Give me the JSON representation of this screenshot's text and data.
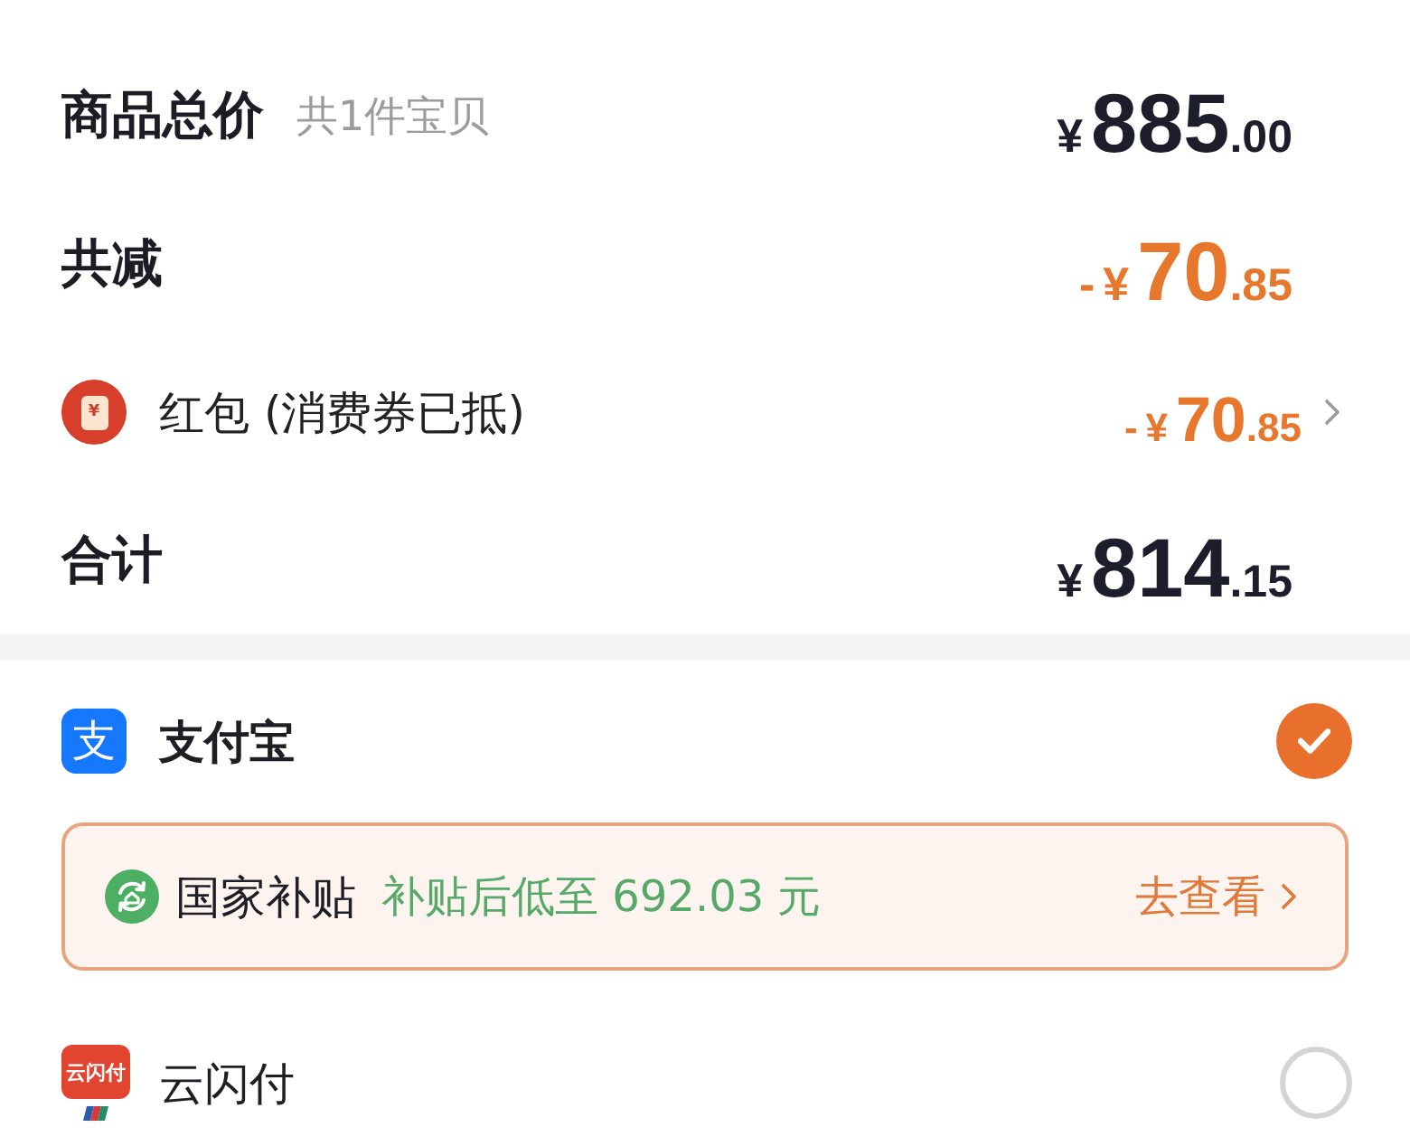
{
  "summary": [
    {
      "kind": "subtotal",
      "label": "商品总价",
      "note": "共1件宝贝",
      "price": {
        "currency": "¥",
        "whole": "885",
        "cents": ".00"
      }
    },
    {
      "kind": "discount",
      "label": "共减",
      "price": {
        "sign": "-",
        "currency": "¥",
        "whole": "70",
        "cents": ".85"
      }
    },
    {
      "kind": "coupon",
      "icon_glyph": "¥",
      "label": "红包 (消费券已抵)",
      "price": {
        "sign": "-",
        "currency": "¥",
        "whole": "70",
        "cents": ".85"
      }
    },
    {
      "kind": "total",
      "label": "合计",
      "price": {
        "currency": "¥",
        "whole": "814",
        "cents": ".15"
      }
    }
  ],
  "payments": [
    {
      "kind": "alipay",
      "logo_text": "支",
      "name": "支付宝",
      "selected": true,
      "promo": {
        "title": "国家补贴",
        "text": "补贴后低至 692.03 元",
        "action": "去查看"
      }
    },
    {
      "kind": "unionpay",
      "logo_text": "云闪付",
      "name": "云闪付",
      "selected": false
    }
  ]
}
